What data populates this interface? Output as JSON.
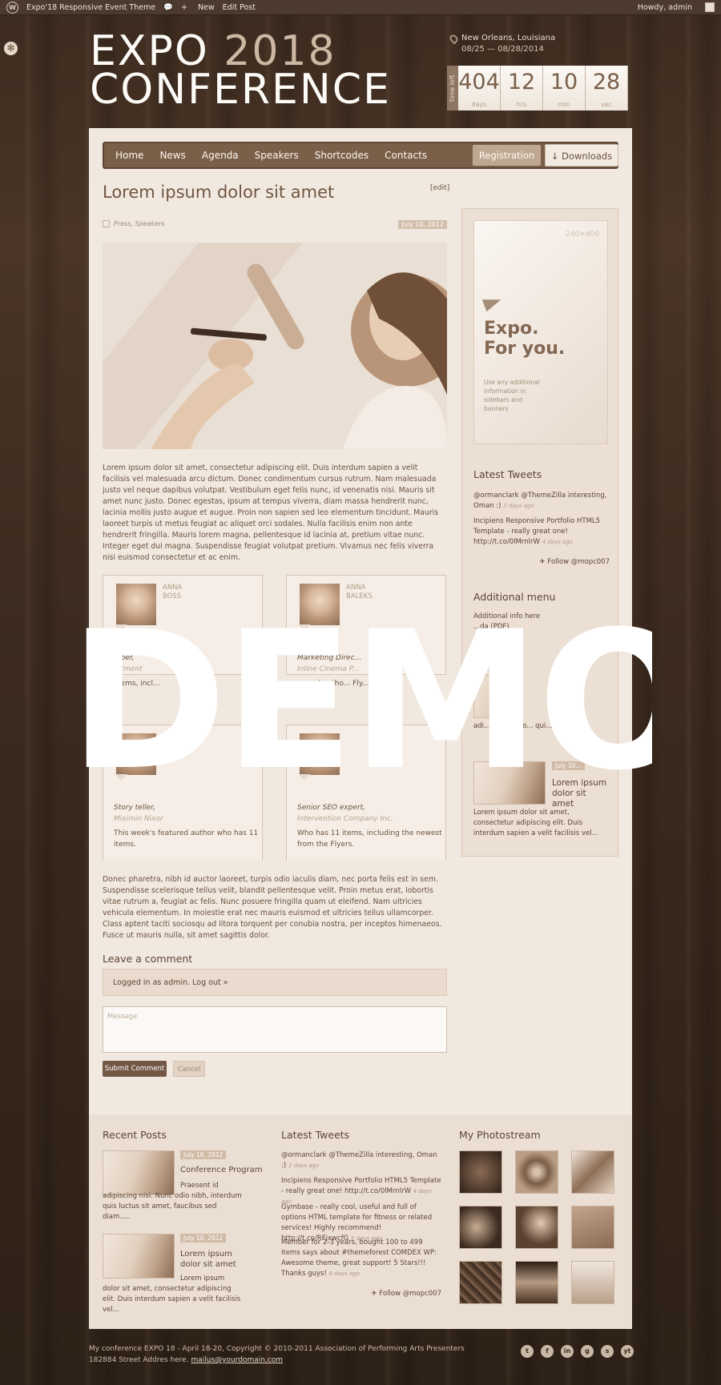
{
  "adminbar": {
    "site": "Expo'18 Responsive Event Theme",
    "new": "New",
    "edit": "Edit Post",
    "howdy": "Howdy, admin"
  },
  "logo": {
    "expo": "EXPO",
    "year": "2018",
    "conf": "CONFERENCE"
  },
  "location": {
    "city": "New Orleans, Louisiana",
    "dates": "08/25 — 08/28/2014"
  },
  "countdown": {
    "label": "time left",
    "items": [
      {
        "n": "404",
        "u": "days"
      },
      {
        "n": "12",
        "u": "hrs"
      },
      {
        "n": "10",
        "u": "min"
      },
      {
        "n": "28",
        "u": "sec"
      }
    ]
  },
  "nav": {
    "items": [
      "Home",
      "News",
      "Agenda",
      "Speakers",
      "Shortcodes",
      "Contacts"
    ],
    "registration": "Registration",
    "downloads": "↓ Downloads"
  },
  "post": {
    "title": "Lorem ipsum dolor sit amet",
    "edit": "[edit]",
    "cats": "Press, Speakers",
    "date": "July 10, 2012",
    "body1": "Lorem ipsum dolor sit amet, consectetur adipiscing elit. Duis interdum sapien a velit facilisis vel malesuada arcu dictum. Donec condimentum cursus rutrum. Nam malesuada justo vel neque dapibus volutpat. Vestibulum eget felis nunc, id venenatis nisi. Mauris sit amet nunc justo. Donec egestas, ipsum at tempus viverra, diam massa hendrerit nunc, lacinia mollis justo augue et augue. Proin non sapien sed leo elementum tincidunt. Mauris laoreet turpis ut metus feugiat ac aliquet orci sodales. Nulla facilisis enim non ante hendrerit fringilla. Mauris lorem magna, pellentesque id lacinia at, pretium vitae nunc. Integer eget dui magna. Suspendisse feugiat volutpat pretium. Vivamus nec felis viverra nisi euismod consectetur et ac enim.",
    "body2": "Donec pharetra, nibh id auctor laoreet, turpis odio iaculis diam, nec porta felis est in sem. Suspendisse scelerisque tellus velit, blandit pellentesque velit. Proin metus erat, lobortis vitae rutrum a, feugiat ac felis. Nunc posuere fringilla quam ut eleifend. Nam ultricies vehicula elementum. In molestie erat nec mauris euismod et ultricies tellus ullamcorper. Class aptent taciti sociosqu ad litora torquent per conubia nostra, per inceptos himenaeos. Fusce ut mauris nulla, sit amet sagittis dolor."
  },
  "speakers": [
    {
      "first": "ANNA",
      "last": "BOSS",
      "role": "...per,",
      "company": "...tment",
      "desc": "...ems, incl..."
    },
    {
      "first": "ANNA",
      "last": "BALEKS",
      "role": "Marketing Direc...",
      "company": "Inline Cinema P...",
      "desc": "...ured autho... Fly...ng."
    },
    {
      "first": "JIM",
      "last": "MORISS...",
      "role": "Story teller,",
      "company": "Miximin Nixor",
      "desc": "This week's featured author who has 11 items."
    },
    {
      "first": "",
      "last": "",
      "role": "Senior SEO expert,",
      "company": "Intervention Company Inc.",
      "desc": "Who has 11 items, including the newest from the Flyers."
    }
  ],
  "comment": {
    "heading": "Leave a comment",
    "logged": "Logged in as admin. Log out »",
    "placeholder": "Message",
    "submit": "Submit Comment",
    "cancel": "Cancel"
  },
  "sidebar": {
    "ad_size": "240×400",
    "ad_big1": "Expo.",
    "ad_big2": "For you.",
    "ad_small": "Use any additional information in sidebars and banners",
    "tweets_title": "Latest Tweets",
    "tweet1": "@ormanclark @ThemeZilla interesting, Oman :)",
    "tweet1_time": "3 days ago",
    "tweet2": "Incipiens Responsive Portfolio HTML5 Template - really great one! http://t.co/0lMrnlrW",
    "tweet2_time": "4 days ago",
    "follow": "Follow @mopc007",
    "menu_title": "Additional menu",
    "menu1": "Additional info here",
    "menu2": "...da (PDF)",
    "posts_title": "...sts",
    "post_mini": "adi... Nunc odio... qui... rhoncus ...",
    "post_date": "July 10...",
    "post_title": "Lorem ipsum dolor sit amet",
    "post_text": "Lorem ipsum dolor sit amet, consectetur adipiscing elit. Duis interdum sapien a velit facilisis vel..."
  },
  "footer": {
    "recent_title": "Recent Posts",
    "rp1_date": "July 10, 2012",
    "rp1_title": "Conference Program",
    "rp1_text": "Praesent id adipiscing nisi. Nunc odio nibh, interdum quis luctus sit amet, faucibus sed diam.....",
    "rp2_date": "July 10, 2012",
    "rp2_title": "Lorem ipsum dolor sit amet",
    "rp2_text": "Lorem ipsum dolor sit amet, consectetur adipiscing elit. Duis interdum sapien a velit facilisis vel...",
    "tweets_title": "Latest Tweets",
    "t1": "@ormanclark @ThemeZilla interesting, Oman :)",
    "t1_time": "3 days ago",
    "t2": "Incipiens Responsive Portfolio HTML5 Template - really great one! http://t.co/0lMrnlrW",
    "t2_time": "4 days ago",
    "t3": "Gymbase - really cool, useful and full of options HTML template for fitness or related services! Highly recommend! http://t.co/RFjxwcfG",
    "t3_time": "5 days ago",
    "t4": "Member for 2-3 years, bought 100 to 499 items says about #themeforest COMDEX WP: Awesome theme, great support! 5 Stars!!! Thanks guys!",
    "t4_time": "6 days ago",
    "follow": "Follow @mopc007",
    "photo_title": "My Photostream",
    "copy1": "My conference EXPO 18 - April 18-20, Copyright © 2010-2011 Association of Performing Arts Presenters",
    "copy2": "182884 Street Addres here.",
    "mail": "mailus@yourdomain.com"
  },
  "social": [
    "t",
    "f",
    "in",
    "g",
    "s",
    "yt"
  ],
  "watermark": "DEMO"
}
